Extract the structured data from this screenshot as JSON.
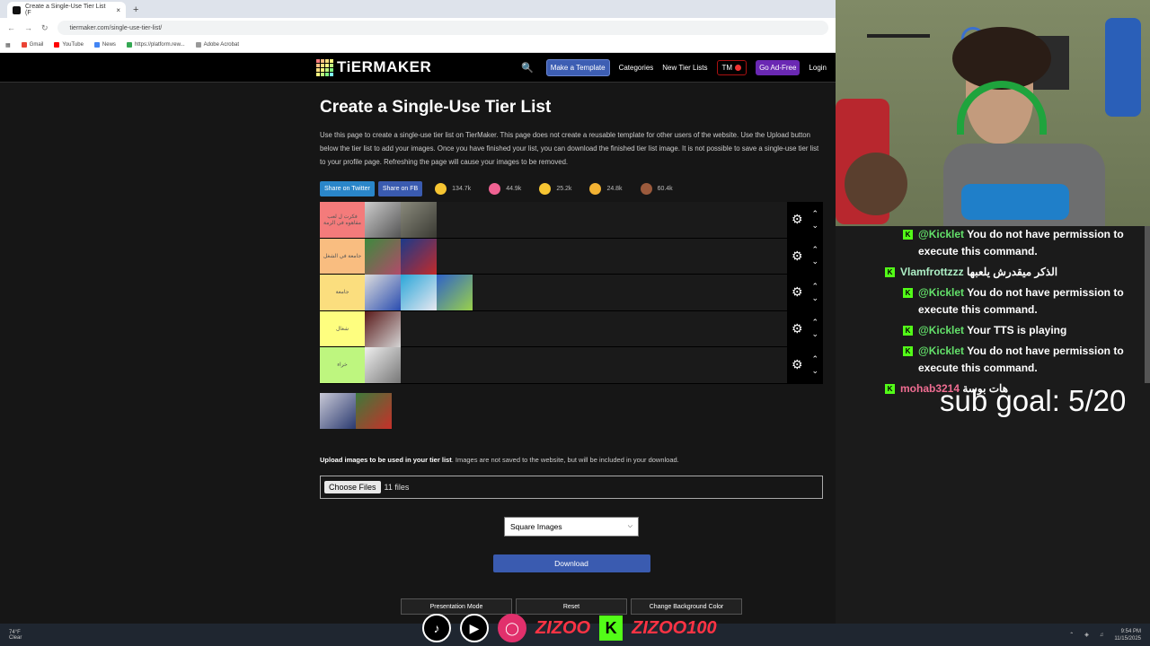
{
  "browser": {
    "tab_title": "Create a Single-Use Tier List (F",
    "tab_close": "×",
    "new_tab": "+",
    "url": "tiermaker.com/single-use-tier-list/",
    "bookmarks": [
      "Gmail",
      "YouTube",
      "News",
      "https://platform.rew...",
      "Adobe Acrobat"
    ]
  },
  "site": {
    "logo": "TiERMAKER",
    "nav": {
      "make_template": "Make a Template",
      "categories": "Categories",
      "new_tier_lists": "New Tier Lists",
      "tm": "TM",
      "ad_free": "Go Ad-Free",
      "login": "Login"
    }
  },
  "page": {
    "title": "Create a Single-Use Tier List",
    "intro": "Use this page to create a single-use tier list on TierMaker. This page does not create a reusable template for other users of the website. Use the Upload button below the tier list to add your images. Once you have finished your list, you can download the finished tier list image. It is not possible to save a single-use tier list to your profile page. Refreshing the page will cause your images to be removed.",
    "share_twitter": "Share on Twitter",
    "share_fb": "Share on FB",
    "reactions": [
      {
        "icon": "smile-emoji-icon",
        "count": "134.7k",
        "color": "#f6c532"
      },
      {
        "icon": "heart-eyes-emoji-icon",
        "count": "44.9k",
        "color": "#f06292"
      },
      {
        "icon": "laugh-emoji-icon",
        "count": "25.2k",
        "color": "#f6c532"
      },
      {
        "icon": "clap-emoji-icon",
        "count": "24.8k",
        "color": "#f2b233"
      },
      {
        "icon": "poop-emoji-icon",
        "count": "60.4k",
        "color": "#9b5a3c"
      }
    ],
    "tiers": [
      {
        "label": "فكرت ل لعب مقاهوه في الرمة",
        "color": "#f47b7b",
        "items": 2
      },
      {
        "label": "جامعة في الشغل",
        "color": "#f9bd80",
        "items": 2
      },
      {
        "label": "جامعة",
        "color": "#fbde7e",
        "items": 3
      },
      {
        "label": "شغال",
        "color": "#fefe7f",
        "items": 1
      },
      {
        "label": "خراء",
        "color": "#bef67f",
        "items": 1
      }
    ],
    "upload_bold": "Upload images to be used in your tier list",
    "upload_rest": ". Images are not saved to the website, but will be included in your download.",
    "choose_files": "Choose Files",
    "files_count": "11 files",
    "select_value": "Square Images",
    "download": "Download",
    "presentation_mode": "Presentation Mode",
    "reset": "Reset",
    "change_bg": "Change Background Color"
  },
  "chat": [
    {
      "user": "@Kicklet",
      "text": "You do not have permission to execute this command.",
      "badge": true
    },
    {
      "user": "Vlamfrottzzz",
      "text": "الذكر ميقدرش يلعبها",
      "badge": true
    },
    {
      "user": "@Kicklet",
      "text": "You do not have permission to execute this command.",
      "badge": true
    },
    {
      "user": "@Kicklet",
      "text": "Your TTS is playing",
      "badge": true
    },
    {
      "user": "@Kicklet",
      "text": "You do not have permission to execute this command.",
      "badge": true
    },
    {
      "user": "mohab3214",
      "text": "هات بوسة",
      "badge": true
    }
  ],
  "overlay": {
    "sub_goal": "sub goal: 5/20",
    "handle_1": "ZIZOO",
    "handle_2": "ZIZOO100"
  },
  "taskbar": {
    "temp": "74°F",
    "weather": "Clear",
    "time": "9:54 PM",
    "date": "11/15/2025"
  }
}
